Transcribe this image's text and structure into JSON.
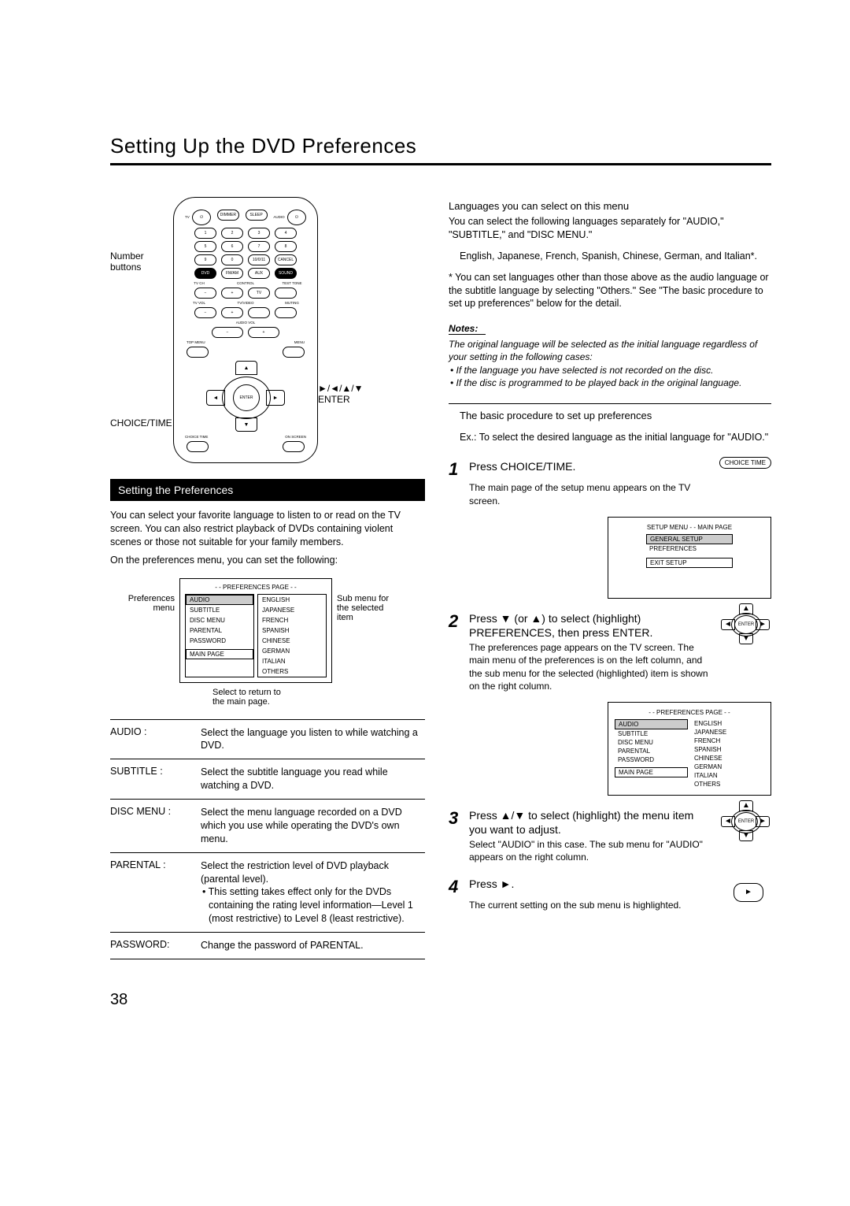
{
  "page_title": "Setting Up the DVD Preferences",
  "page_number": "38",
  "remote_labels": {
    "number_buttons": "Number buttons",
    "choice_time": "CHOICE/TIME",
    "arrows_enter": "►/◄/▲/▼\nENTER"
  },
  "remote": {
    "top": {
      "tv_power": "⏻",
      "dimmer": "DIMMER",
      "sleep": "SLEEP",
      "audio_power": "⏻",
      "tv_lbl": "TV",
      "audio_lbl": "AUDIO"
    },
    "nums": [
      "1",
      "2",
      "3",
      "4",
      "5",
      "6",
      "7",
      "8",
      "9",
      "0",
      "10/0/11",
      "CANCEL"
    ],
    "src_row": [
      "DVD",
      "FM/AM",
      "AUX",
      "SOUND"
    ],
    "group": {
      "tvch": "TV CH",
      "control": "CONTROL",
      "testtone": "TEST TONE",
      "tv": "TV",
      "tvvol": "TV VOL",
      "tvvideo": "TV/VIDEO",
      "muting": "MUTING",
      "audiovol": "AUDIO VOL"
    },
    "bottom": {
      "top_menu": "TOP MENU",
      "menu": "MENU",
      "enter": "ENTER",
      "choicetime": "CHOICE TIME",
      "onscreen": "ON SCREEN"
    }
  },
  "section_header": "Setting the Preferences",
  "intro_text": "You can select your favorite language to listen to or read on the TV screen. You can also restrict playback of DVDs containing violent scenes or those not suitable for your family members.",
  "intro_text2": "On the preferences menu, you can set the following:",
  "pref_diagram": {
    "left_label": "Preferences menu",
    "right_label": "Sub menu for the selected item",
    "header": "- - PREFERENCES PAGE - -",
    "left_items": [
      "AUDIO",
      "SUBTITLE",
      "DISC MENU",
      "PARENTAL",
      "PASSWORD",
      "MAIN PAGE"
    ],
    "right_items": [
      "ENGLISH",
      "JAPANESE",
      "FRENCH",
      "SPANISH",
      "CHINESE",
      "GERMAN",
      "ITALIAN",
      "OTHERS"
    ],
    "caption": "Select to return to\nthe main page."
  },
  "defs": [
    {
      "term": "AUDIO :",
      "def": "Select the language you listen to while watching a DVD."
    },
    {
      "term": "SUBTITLE :",
      "def": "Select the subtitle language you read while watching a DVD."
    },
    {
      "term": "DISC MENU :",
      "def": "Select the menu language recorded on a DVD which you use while operating the DVD's own menu."
    },
    {
      "term": "PARENTAL :",
      "def": "Select the restriction level of DVD playback (parental level).",
      "bullet": "• This setting takes effect only for the DVDs containing the rating level information—Level 1 (most restrictive) to Level 8 (least restrictive)."
    },
    {
      "term": "PASSWORD:",
      "def": "Change the password of PARENTAL."
    }
  ],
  "right": {
    "lang_heading": "Languages you can select on this menu",
    "lang_body1": "You can select the following languages separately for \"AUDIO,\" \"SUBTITLE,\" and \"DISC MENU.\"",
    "lang_body2": "English, Japanese, French, Spanish, Chinese, German, and Italian*.",
    "lang_body3": "* You can set languages other than those above as the audio language or the subtitle language by selecting \"Others.\" See \"The basic procedure to set up preferences\" below for the detail.",
    "notes_head": "Notes:",
    "notes_body": "The original language will be selected as the initial language regardless of your setting in the following cases:",
    "notes_b1": "• If the language you have selected is not recorded on the disc.",
    "notes_b2": "• If the disc is programmed to be played back in the original language.",
    "proc_heading": "The basic procedure to set up preferences",
    "proc_ex": "Ex.: To select the desired language as the initial language for \"AUDIO.\"",
    "steps": {
      "s1": {
        "text": "Press CHOICE/TIME.",
        "sub": "The main page of the setup menu appears on the TV screen.",
        "btn": "CHOICE TIME"
      },
      "s2": {
        "text": "Press ▼ (or ▲) to select (highlight) PREFERENCES,  then press ENTER.",
        "sub": "The preferences page appears on the TV screen. The main menu of the preferences is on the left column, and the sub menu for the selected (highlighted) item is shown on the right column.",
        "enter": "ENTER"
      },
      "s3": {
        "text": "Press ▲/▼ to select (highlight) the menu item you want to adjust.",
        "sub": "Select \"AUDIO\" in this case. The sub menu for \"AUDIO\" appears on the right column.",
        "enter": "ENTER"
      },
      "s4": {
        "text": "Press ►.",
        "sub": "The current setting on the sub menu is highlighted."
      }
    },
    "setup_menu": {
      "header": "SETUP MENU - - MAIN PAGE",
      "items": [
        "GENERAL SETUP",
        "PREFERENCES",
        "EXIT SETUP"
      ]
    },
    "pref_page": {
      "header": "- - PREFERENCES PAGE - -",
      "left_items": [
        "AUDIO",
        "SUBTITLE",
        "DISC MENU",
        "PARENTAL",
        "PASSWORD",
        "MAIN PAGE"
      ],
      "right_items": [
        "ENGLISH",
        "JAPANESE",
        "FRENCH",
        "SPANISH",
        "CHINESE",
        "GERMAN",
        "ITALIAN",
        "OTHERS"
      ]
    }
  }
}
